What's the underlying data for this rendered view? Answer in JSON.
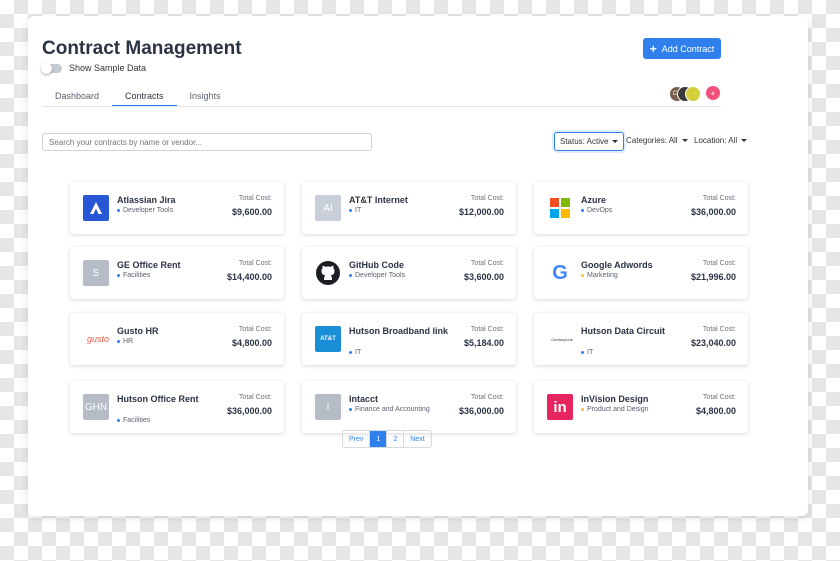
{
  "page": {
    "title": "Contract Management",
    "toggle_label": "Show Sample Data",
    "add_button": "Add Contract",
    "add_icon": "+",
    "tabs": [
      "Dashboard",
      "Contracts",
      "Insights"
    ],
    "active_tab": "Contracts",
    "avatars": [
      {
        "initials": "CR",
        "color": "#7a5c4a"
      },
      {
        "initials": "",
        "color": "#3a3a3a"
      },
      {
        "initials": "",
        "color": "#d4cf3a"
      }
    ],
    "avatar_add": "+"
  },
  "search": {
    "placeholder": "Search your contracts by name or vendor..."
  },
  "filters": {
    "status": "Status: Active",
    "categories": "Categories: All",
    "location": "Location: All"
  },
  "cost_label": "Total Cost:",
  "contracts": [
    {
      "name": "Atlassian Jira",
      "category": "Developer Tools",
      "cost": "$9,600.00",
      "dot": "#2f80ed",
      "logo": "atlassian-logo",
      "logo_bg": "#2857d6",
      "logo_text": "",
      "logo_color": "#ffffff"
    },
    {
      "name": "AT&T Internet",
      "category": "IT",
      "cost": "$12,000.00",
      "dot": "#2f80ed",
      "logo": "placeholder-logo",
      "logo_bg": "#c9cfd8",
      "logo_text": "AI",
      "logo_color": "#ffffff"
    },
    {
      "name": "Azure",
      "category": "DevOps",
      "cost": "$36,000.00",
      "dot": "#2f80ed",
      "logo": "microsoft-logo",
      "logo_bg": "#ffffff",
      "logo_text": "",
      "logo_color": "#ffffff"
    },
    {
      "name": "GE Office Rent",
      "category": "Facilities",
      "cost": "$14,400.00",
      "dot": "#2f80ed",
      "logo": "placeholder-logo",
      "logo_bg": "#b5bcc6",
      "logo_text": "S",
      "logo_color": "#ffffff"
    },
    {
      "name": "GitHub Code",
      "category": "Developer Tools",
      "cost": "$3,600.00",
      "dot": "#2f80ed",
      "logo": "github-logo",
      "logo_bg": "#ffffff",
      "logo_text": "",
      "logo_color": "#ffffff"
    },
    {
      "name": "Google Adwords",
      "category": "Marketing",
      "cost": "$21,996.00",
      "dot": "#f2c037",
      "logo": "google-logo",
      "logo_bg": "#ffffff",
      "logo_text": "G",
      "logo_color": "#4285f4"
    },
    {
      "name": "Gusto HR",
      "category": "HR",
      "cost": "$4,800.00",
      "dot": "#2f80ed",
      "logo": "gusto-logo",
      "logo_bg": "#ffffff",
      "logo_text": "gusto",
      "logo_color": "#f45d48"
    },
    {
      "name": "Hutson Broadband link",
      "category": "IT",
      "cost": "$5,184.00",
      "dot": "#2f80ed",
      "logo": "att-logo",
      "logo_bg": "#1a8fd8",
      "logo_text": "AT&T",
      "logo_color": "#ffffff"
    },
    {
      "name": "Hutson Data Circuit",
      "category": "IT",
      "cost": "$23,040.00",
      "dot": "#2f80ed",
      "logo": "centurylink-logo",
      "logo_bg": "#ffffff",
      "logo_text": "CenturyLink",
      "logo_color": "#333333"
    },
    {
      "name": "Hutson Office Rent",
      "category": "Facilities",
      "cost": "$36,000.00",
      "dot": "#2f80ed",
      "logo": "placeholder-logo",
      "logo_bg": "#b5bcc6",
      "logo_text": "GHN",
      "logo_color": "#ffffff"
    },
    {
      "name": "Intacct",
      "category": "Finance and Accounting",
      "cost": "$36,000.00",
      "dot": "#2f80ed",
      "logo": "placeholder-logo",
      "logo_bg": "#b5bcc6",
      "logo_text": "I",
      "logo_color": "#ffffff"
    },
    {
      "name": "InVision Design",
      "category": "Product and Design",
      "cost": "$4,800.00",
      "dot": "#f2c037",
      "logo": "invision-logo",
      "logo_bg": "#e6245f",
      "logo_text": "in",
      "logo_color": "#ffffff"
    }
  ],
  "pagination": [
    "Prev",
    "1",
    "2",
    "Next"
  ],
  "current_page": "1"
}
